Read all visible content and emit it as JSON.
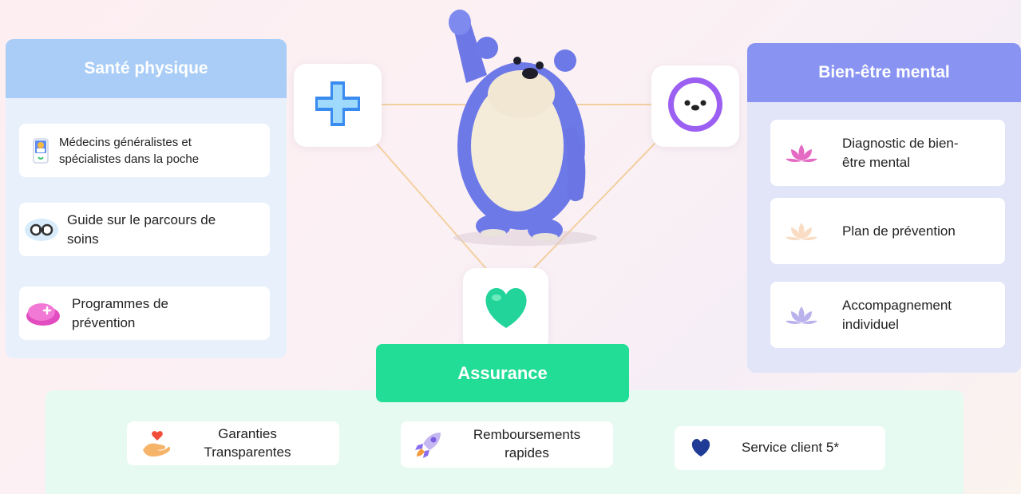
{
  "left_panel": {
    "title": "Santé physique",
    "items": [
      {
        "label": "Médecins généralistes et spécialistes dans la poche",
        "icon": "doctor-phone-icon"
      },
      {
        "label": "Guide sur le parcours de soins",
        "icon": "binoculars-icon"
      },
      {
        "label": "Programmes de prévention",
        "icon": "pink-shield-icon"
      }
    ]
  },
  "right_panel": {
    "title": "Bien-être mental",
    "items": [
      {
        "label": "Diagnostic de bien-être mental",
        "icon": "lotus-icon"
      },
      {
        "label": "Plan de prévention",
        "icon": "lotus-icon"
      },
      {
        "label": "Accompagnement individuel",
        "icon": "lotus-icon"
      }
    ]
  },
  "center": {
    "cross_icon": "medical-cross-icon",
    "face_icon": "smiley-face-icon",
    "heart_icon": "green-heart-icon",
    "mascot": "blue-furry-mascot-waving"
  },
  "assurance": {
    "title": "Assurance",
    "items": [
      {
        "label": "Garanties Transparentes",
        "icon": "heart-hand-icon"
      },
      {
        "label": "Remboursements rapides",
        "icon": "rocket-icon"
      },
      {
        "label": "Service client 5*",
        "icon": "blue-heart-icon"
      }
    ]
  },
  "colors": {
    "physique_header": "#a9cdf7",
    "mental_header": "#8994f2",
    "assurance_green": "#22dd96",
    "connector": "#f3cfa0"
  }
}
